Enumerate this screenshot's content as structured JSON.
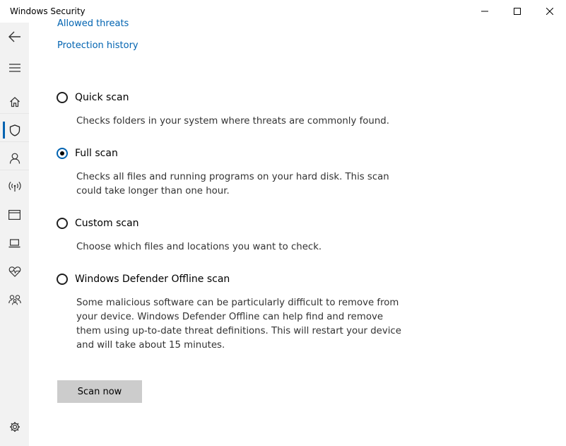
{
  "window": {
    "title": "Windows Security",
    "controls": {
      "minimize": "minimize-icon",
      "maximize": "maximize-icon",
      "close": "close-icon"
    }
  },
  "sidebar": {
    "items": [
      {
        "name": "back",
        "icon": "back-arrow-icon"
      },
      {
        "name": "menu",
        "icon": "hamburger-icon"
      },
      {
        "name": "home",
        "icon": "home-icon"
      },
      {
        "name": "virus-threat-protection",
        "icon": "shield-icon",
        "active": true
      },
      {
        "name": "account-protection",
        "icon": "person-icon"
      },
      {
        "name": "firewall-network",
        "icon": "wireless-icon"
      },
      {
        "name": "app-browser-control",
        "icon": "browser-window-icon"
      },
      {
        "name": "device-security",
        "icon": "laptop-icon"
      },
      {
        "name": "device-performance-health",
        "icon": "heart-pulse-icon"
      },
      {
        "name": "family-options",
        "icon": "family-icon"
      },
      {
        "name": "settings",
        "icon": "gear-icon"
      }
    ],
    "accent": "#0063b1"
  },
  "links": {
    "allowed_threats": "Allowed threats",
    "protection_history": "Protection history"
  },
  "scan_options": [
    {
      "label": "Quick scan",
      "selected": false,
      "description": [
        "Checks folders in your system where threats are commonly found."
      ]
    },
    {
      "label": "Full scan",
      "selected": true,
      "description": [
        "Checks all files and running programs on your hard disk. This scan",
        "could take longer than one hour."
      ]
    },
    {
      "label": "Custom scan",
      "selected": false,
      "description": [
        "Choose which files and locations you want to check."
      ]
    },
    {
      "label": "Windows Defender Offline scan",
      "selected": false,
      "description": [
        "Some malicious software can be particularly difficult to remove from",
        "your device. Windows Defender Offline can help find and remove",
        "them using up-to-date threat definitions. This will restart your device",
        "and will take about 15 minutes."
      ]
    }
  ],
  "actions": {
    "scan_now": "Scan now"
  },
  "colors": {
    "link": "#0063b1",
    "button_bg": "#cccccc",
    "sidebar_bg": "#f2f2f2"
  }
}
